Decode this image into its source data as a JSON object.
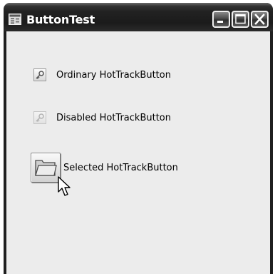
{
  "window": {
    "title": "ButtonTest",
    "app_icon": "window-form-icon",
    "controls": {
      "minimize_icon": "minimize-icon",
      "maximize_icon": "maximize-icon",
      "close_icon": "close-icon"
    }
  },
  "buttons": [
    {
      "label": "Ordinary HotTrackButton",
      "icon": "key-icon",
      "state": "normal"
    },
    {
      "label": "Disabled HotTrackButton",
      "icon": "key-icon",
      "state": "disabled"
    },
    {
      "label": "Selected HotTrackButton",
      "icon": "folder-icon",
      "state": "selected"
    }
  ],
  "cursor": "arrow-cursor-icon"
}
